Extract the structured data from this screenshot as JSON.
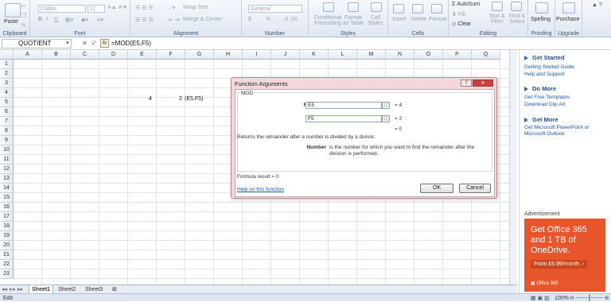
{
  "ribbon": {
    "clipboard": {
      "paste": "Paste",
      "label": "Clipboard"
    },
    "font": {
      "name": "Calibri",
      "size": "11",
      "label": "Font",
      "bold": "B",
      "italic": "I",
      "underline": "U"
    },
    "alignment": {
      "wrap": "Wrap Text",
      "merge": "Merge & Center",
      "label": "Alignment"
    },
    "number": {
      "format": "General",
      "label": "Number",
      "currency": "$",
      "percent": "%",
      "comma": ","
    },
    "styles": {
      "conditional": "Conditional Formatting",
      "format_table": "Format as Table",
      "cell_styles": "Cell Styles",
      "label": "Styles"
    },
    "cells": {
      "insert": "Insert",
      "delete": "Delete",
      "format": "Format",
      "label": "Cells"
    },
    "editing": {
      "autosum": "AutoSum",
      "fill": "Fill",
      "clear": "Clear",
      "sort": "Sort & Filter",
      "find": "Find & Select",
      "label": "Editing"
    },
    "proofing": {
      "spelling": "Spelling",
      "label": "Proofing"
    },
    "upgrade": {
      "purchase": "Purchase",
      "label": "Upgrade"
    }
  },
  "formula_bar": {
    "name_box": "QUOTIENT",
    "cancel": "✕",
    "enter": "✓",
    "fx": "fx",
    "formula": "=MOD(E5,F5)"
  },
  "sheet": {
    "columns": [
      "A",
      "B",
      "C",
      "D",
      "E",
      "F",
      "G",
      "H",
      "I",
      "J",
      "K",
      "L",
      "M",
      "N",
      "O",
      "P",
      "Q"
    ],
    "rows": [
      "1",
      "2",
      "3",
      "4",
      "5",
      "6",
      "7",
      "8",
      "9",
      "10",
      "11",
      "12",
      "13",
      "14",
      "15",
      "16",
      "17",
      "18",
      "19",
      "20",
      "21",
      "22",
      "23"
    ],
    "cells": {
      "e5": "4",
      "f5": "2",
      "g5": "(E5,F5)"
    }
  },
  "tabs": [
    "Sheet1",
    "Sheet2",
    "Sheet3"
  ],
  "status": {
    "mode": "Edit",
    "zoom": "100%"
  },
  "pane": {
    "get_started": "Get Started",
    "getting_started_guide": "Getting Started Guide",
    "help_support": "Help and Support",
    "do_more": "Do More",
    "free_templates": "Get Free Templates",
    "clip_art": "Download Clip Art",
    "get_more": "Get More",
    "powerpoint": "Get Microsoft PowerPoint or Microsoft Outlook",
    "advertisement": "Advertisement",
    "ad_line1": "Get Office 365",
    "ad_line2": "and 1 TB of",
    "ad_line3": "OneDrive.",
    "ad_price": "From £5.99/month.",
    "ad_brand": "Office 365",
    "ad_color": "#e8552b"
  },
  "dialog": {
    "title": "Function Arguments",
    "help_icon": "?",
    "close_icon": "✕",
    "function": "MOD",
    "arg1_label": "Number",
    "arg1_value": "E5",
    "arg1_result": "= 4",
    "arg2_label": "Divisor",
    "arg2_value": "F5",
    "arg2_result": "= 2",
    "total_result": "= 0",
    "description": "Returns the remainder after a number is divided by a divisor.",
    "arg_desc_label": "Number",
    "arg_desc": "is the number for which you want to find the remainder after the division is performed.",
    "formula_result": "Formula result =   0",
    "help_link": "Help on this function",
    "ok": "OK",
    "cancel": "Cancel"
  }
}
